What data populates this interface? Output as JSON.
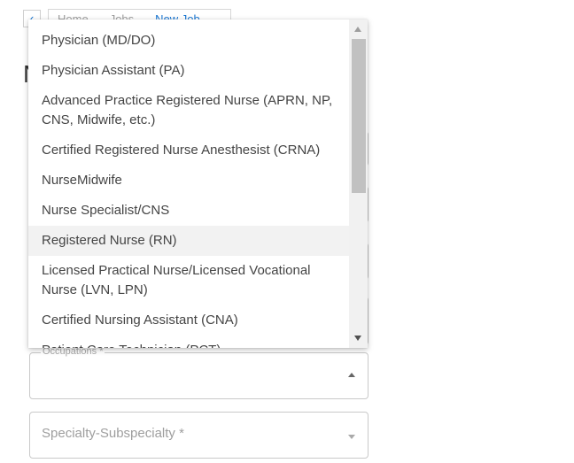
{
  "breadcrumb": {
    "back_label": "‹",
    "items": [
      "Home",
      "Jobs",
      "New Job"
    ]
  },
  "page_title_initial": "N",
  "form": {
    "occupations_label": "Occupations *",
    "specialty_placeholder": "Specialty-Subspecialty *"
  },
  "dropdown": {
    "options": [
      "Physician (MD/DO)",
      "Physician Assistant (PA)",
      "Advanced Practice Registered Nurse (APRN, NP, CNS, Midwife, etc.)",
      "Certified Registered Nurse Anesthesist (CRNA)",
      "NurseMidwife",
      "Nurse Specialist/CNS",
      "Registered Nurse (RN)",
      "Licensed Practical Nurse/Licensed Vocational Nurse (LVN, LPN)",
      "Certified Nursing Assistant (CNA)",
      "Patient Care Technician (PCT)"
    ],
    "highlighted": "Registered Nurse (RN)"
  },
  "colors": {
    "accent": "#1976d2",
    "highlight_bg": "#f2f2f2",
    "scroll_thumb": "#c1c1c1"
  }
}
